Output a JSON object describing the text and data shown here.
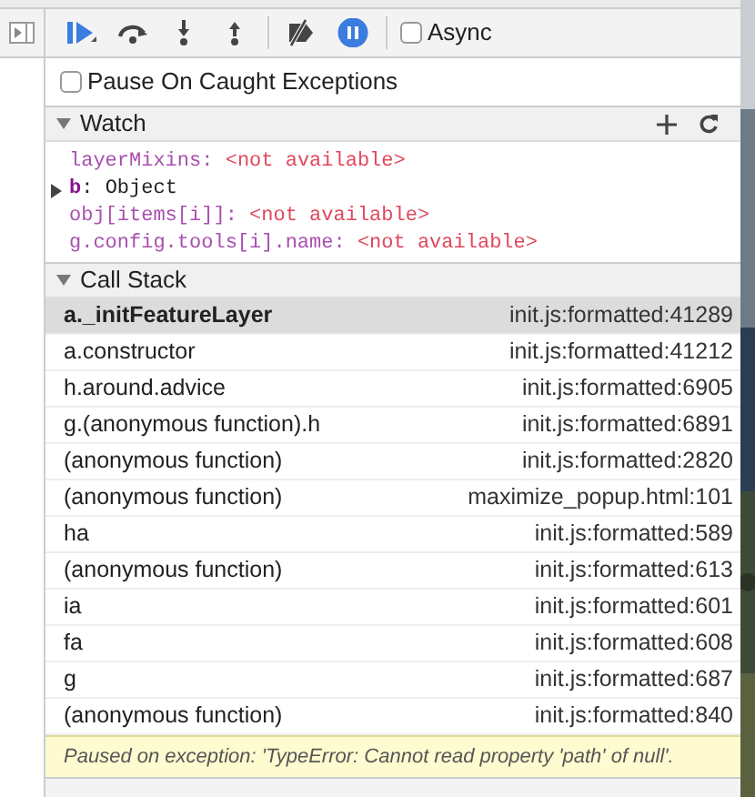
{
  "toolbar": {
    "buttons": [
      {
        "kind": "resume",
        "on": false
      },
      {
        "kind": "step-over",
        "on": false
      },
      {
        "kind": "step-into",
        "on": false
      },
      {
        "kind": "step-out",
        "on": false
      },
      {
        "kind": "deactivate",
        "on": false
      },
      {
        "kind": "pause-exceptions",
        "on": true
      }
    ],
    "async": {
      "label": "Async",
      "checked": false
    }
  },
  "pause_on_caught": {
    "label": "Pause On Caught Exceptions",
    "checked": false
  },
  "watch": {
    "title": "Watch",
    "expanded": true,
    "items": [
      {
        "kind": "expression",
        "name": "layerMixins",
        "separator": ":",
        "value": "<not available>"
      },
      {
        "kind": "object",
        "name": "b",
        "separator": ":",
        "value": "Object",
        "expanded": false
      },
      {
        "kind": "expression",
        "name": "obj[items[i]]",
        "separator": ":",
        "value": "<not available>"
      },
      {
        "kind": "expression",
        "name": "g.config.tools[i].name",
        "separator": ":",
        "value": "<not available>"
      }
    ]
  },
  "call_stack": {
    "title": "Call Stack",
    "expanded": true,
    "frames": [
      {
        "function": "a._initFeatureLayer",
        "location": "init.js:formatted:41289",
        "selected": true
      },
      {
        "function": "a.constructor",
        "location": "init.js:formatted:41212",
        "selected": false
      },
      {
        "function": "h.around.advice",
        "location": "init.js:formatted:6905",
        "selected": false
      },
      {
        "function": "g.(anonymous function).h",
        "location": "init.js:formatted:6891",
        "selected": false
      },
      {
        "function": "(anonymous function)",
        "location": "init.js:formatted:2820",
        "selected": false
      },
      {
        "function": "(anonymous function)",
        "location": "maximize_popup.html:101",
        "selected": false
      },
      {
        "function": "ha",
        "location": "init.js:formatted:589",
        "selected": false
      },
      {
        "function": "(anonymous function)",
        "location": "init.js:formatted:613",
        "selected": false
      },
      {
        "function": "ia",
        "location": "init.js:formatted:601",
        "selected": false
      },
      {
        "function": "fa",
        "location": "init.js:formatted:608",
        "selected": false
      },
      {
        "function": "g",
        "location": "init.js:formatted:687",
        "selected": false
      },
      {
        "function": "(anonymous function)",
        "location": "init.js:formatted:840",
        "selected": false
      }
    ],
    "message": "Paused on exception: 'TypeError: Cannot read property 'path' of null'."
  }
}
